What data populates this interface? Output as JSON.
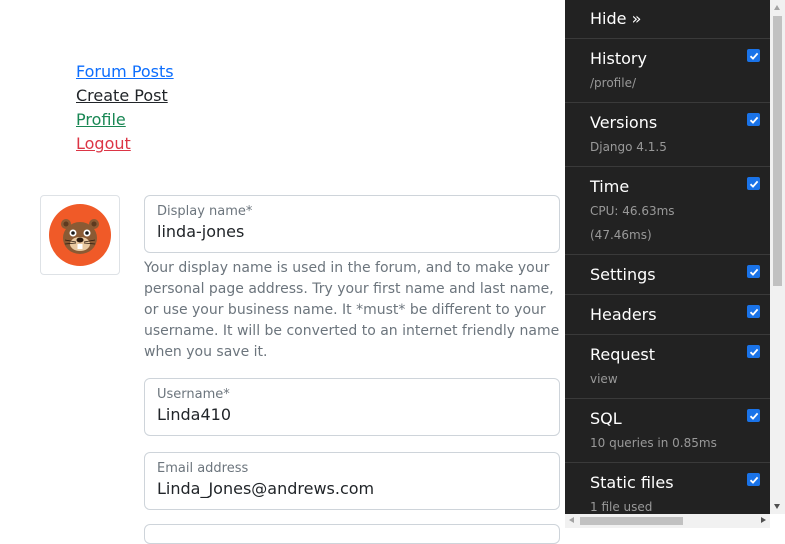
{
  "nav": {
    "forum_posts": "Forum Posts",
    "create_post": "Create Post",
    "profile": "Profile",
    "logout": "Logout"
  },
  "avatar": {
    "icon": "beaver-avatar-icon",
    "color": "#f05a28"
  },
  "form": {
    "display_name": {
      "label": "Display name*",
      "value": "linda-jones"
    },
    "display_name_help": "Your display name is used in the forum, and to make your personal page address. Try your first name and last name, or use your business name. It *must* be different to your username. It will be converted to an internet friendly name when you save it.",
    "username": {
      "label": "Username*",
      "value": "Linda410"
    },
    "email": {
      "label": "Email address",
      "value": "Linda_Jones@andrews.com"
    }
  },
  "toolbar": {
    "hide_label": "Hide »",
    "checkbox_color": "#1a73e8",
    "panels": [
      {
        "title": "History",
        "subtitle": "/profile/",
        "checked": true
      },
      {
        "title": "Versions",
        "subtitle": "Django 4.1.5",
        "checked": true
      },
      {
        "title": "Time",
        "subtitle": "CPU: 46.63ms (47.46ms)",
        "checked": true
      },
      {
        "title": "Settings",
        "subtitle": "",
        "checked": true
      },
      {
        "title": "Headers",
        "subtitle": "",
        "checked": true
      },
      {
        "title": "Request",
        "subtitle": "view",
        "checked": true
      },
      {
        "title": "SQL",
        "subtitle": "10 queries in 0.85ms",
        "checked": true
      },
      {
        "title": "Static files",
        "subtitle": "1 file used",
        "checked": true
      }
    ]
  }
}
